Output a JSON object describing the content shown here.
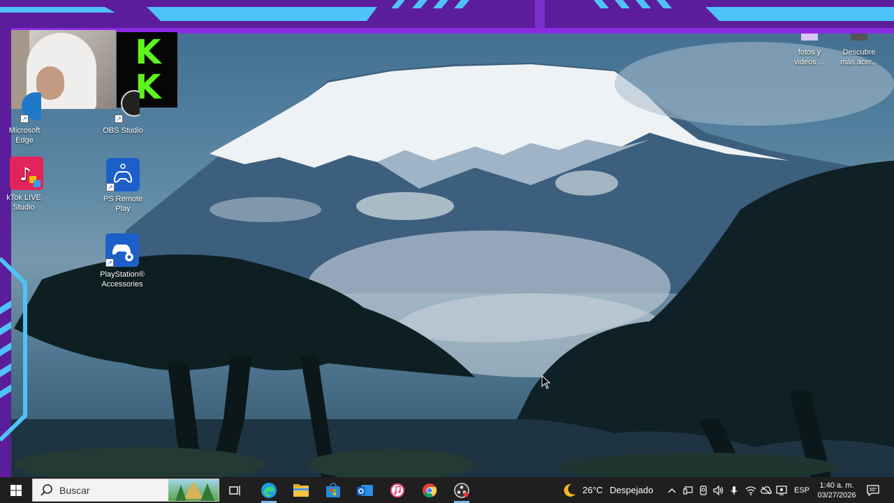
{
  "overlay": {
    "frame_color": "#5b1d9c",
    "accent_color": "#4fc3f7",
    "logo_letters": [
      "K",
      "K"
    ],
    "logo_color": "#5ef31b"
  },
  "desktop": {
    "icons_left": [
      {
        "label_line1": "Microsoft",
        "label_line2": "Edge",
        "icon": "edge-icon"
      },
      {
        "label_line1": "OBS Studio",
        "label_line2": "",
        "icon": "obs-icon"
      },
      {
        "label_line1": "kTok LIVE",
        "label_line2": "Studio",
        "icon": "tiktok-live-icon"
      },
      {
        "label_line1": "PS Remote",
        "label_line2": "Play",
        "icon": "ps-remote-play-icon"
      },
      {
        "label_line1": "PlayStation®",
        "label_line2": "Accessories",
        "icon": "playstation-accessories-icon"
      }
    ],
    "icons_right": [
      {
        "label_line1": "fotos y",
        "label_line2": "videos ...",
        "icon": "photos-icon"
      },
      {
        "label_line1": "Descubre",
        "label_line2": "más acer...",
        "icon": "discover-icon"
      }
    ]
  },
  "taskbar": {
    "search_placeholder": "Buscar",
    "pinned": [
      "task-view-icon",
      "edge-icon",
      "file-explorer-icon",
      "microsoft-store-icon",
      "outlook-icon",
      "itunes-icon",
      "chrome-icon",
      "obs-icon"
    ],
    "weather": {
      "temperature": "26°C",
      "condition": "Despejado",
      "icon": "moon-icon"
    },
    "language": "ESP",
    "time": "1:40 a. m.",
    "date": "03/27/2026"
  }
}
